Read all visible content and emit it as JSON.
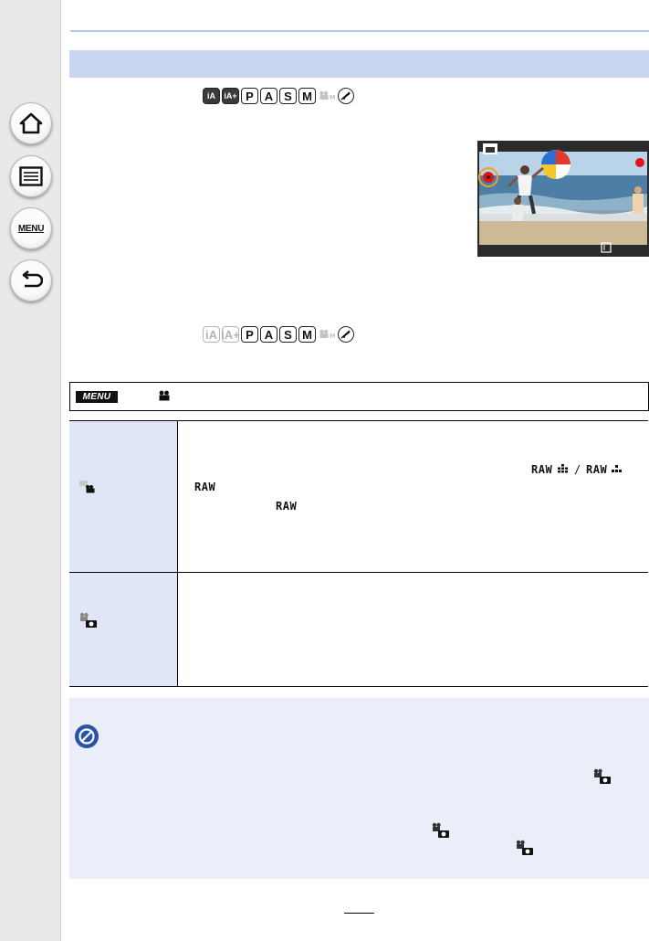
{
  "sidebar": {
    "items": [
      {
        "name": "home",
        "icon": "home-icon"
      },
      {
        "name": "contents",
        "icon": "list-icon"
      },
      {
        "name": "menu",
        "icon": "menu-icon",
        "label": "MENU"
      },
      {
        "name": "back",
        "icon": "back-icon"
      }
    ]
  },
  "modes_available": {
    "labels": [
      "iA",
      "iA+",
      "P",
      "A",
      "S",
      "M",
      "M",
      "C"
    ]
  },
  "modes_row2": {
    "labels": [
      "iA",
      "iA+",
      "P",
      "A",
      "S",
      "M",
      "M",
      "C"
    ]
  },
  "menu_bar": {
    "badge": "MENU"
  },
  "table": {
    "row1": {
      "raw_fine": "RAW",
      "raw_std": "RAW",
      "raw_a": "RAW",
      "raw_b": "RAW",
      "separator": "/"
    }
  },
  "colors": {
    "title_bar": "#c7d5ef",
    "header_cell": "#dfe7f6",
    "note_bg": "#e9eef8",
    "accent_blue": "#2b53a6",
    "record_red": "#e2131a"
  }
}
